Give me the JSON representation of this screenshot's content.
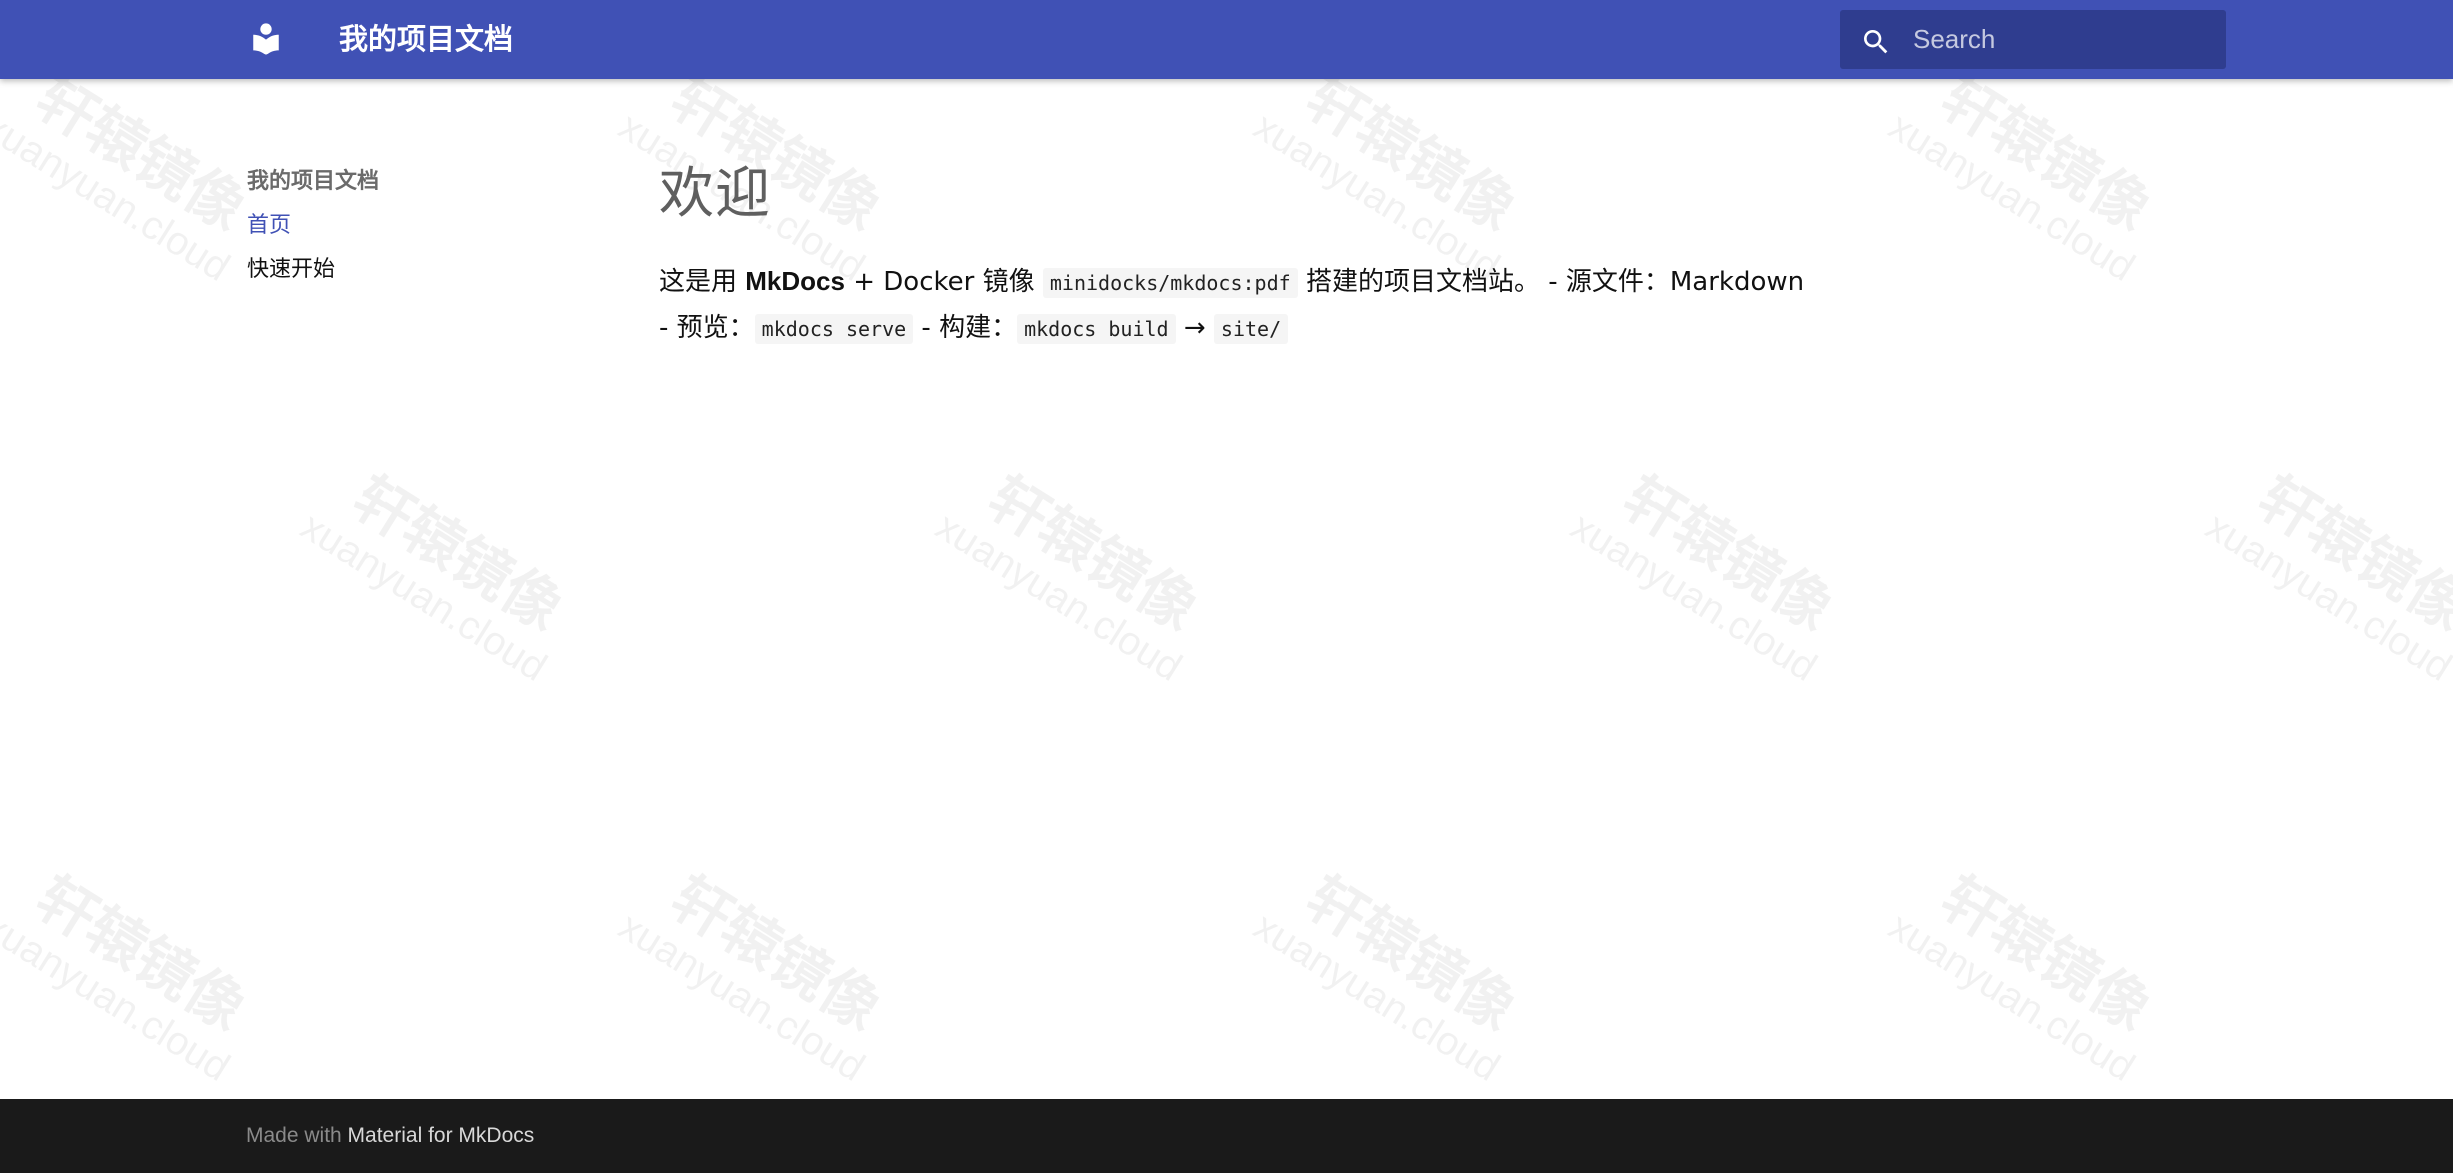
{
  "header": {
    "logo_icon": "book-reader-icon",
    "site_title": "我的项目文档",
    "search_placeholder": "Search",
    "search_icon": "search-icon",
    "background_color": "#4051b5"
  },
  "watermark": {
    "text_cn": "轩辕镜像",
    "text_en": "xuanyuan.cloud"
  },
  "sidebar": {
    "title": "我的项目文档",
    "items": [
      {
        "label": "首页",
        "active": true
      },
      {
        "label": "快速开始",
        "active": false
      }
    ]
  },
  "content": {
    "title": "欢迎",
    "line1": {
      "t1": "这是用 ",
      "bold": "MkDocs",
      "t2": " + Docker 镜像 ",
      "code1": "minidocks/mkdocs:pdf",
      "t3": " 搭建的项目文档站。 - 源文件：Markdown"
    },
    "line2": {
      "t1": "- 预览：",
      "code1": "mkdocs serve",
      "t2": " - 构建：",
      "code2": "mkdocs build",
      "arrow": " → ",
      "code3": "site/"
    }
  },
  "footer": {
    "prefix": "Made with ",
    "link": "Material for MkDocs"
  },
  "colors": {
    "primary": "#4051b5",
    "search_bg": "#2f3d8f",
    "footer_bg": "#1a1a1a",
    "active_link": "#4051b5"
  }
}
